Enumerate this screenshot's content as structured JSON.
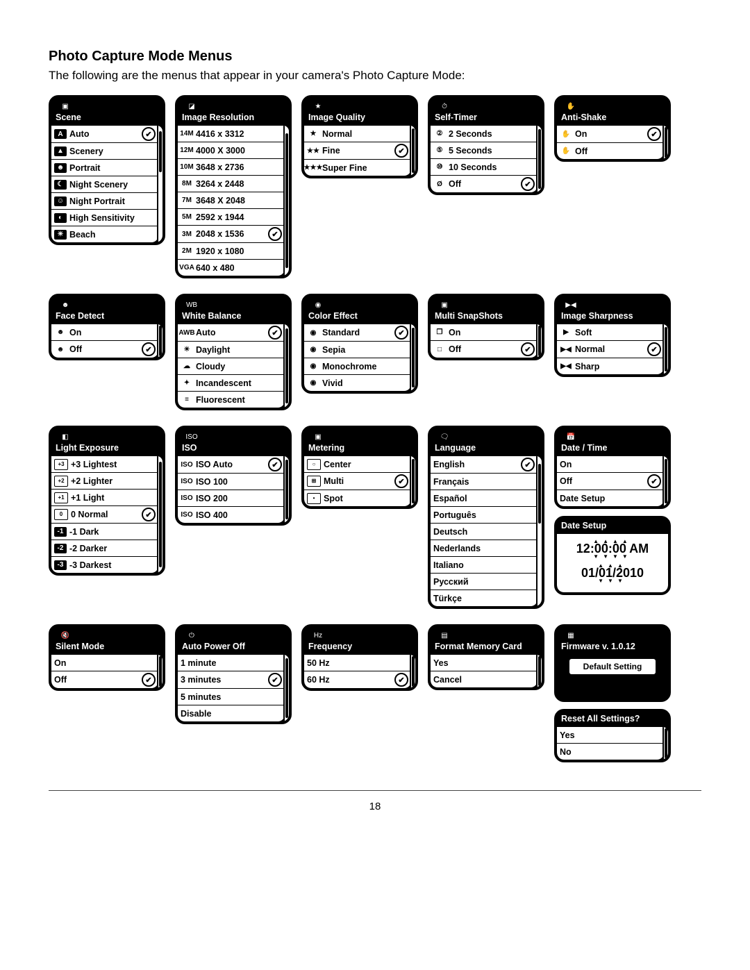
{
  "page": {
    "heading": "Photo Capture Mode Menus",
    "intro": "The following are the menus that appear in your camera's Photo Capture Mode:",
    "number": "18"
  },
  "menus": {
    "scene": {
      "title": "Scene",
      "items": [
        "Auto",
        "Scenery",
        "Portrait",
        "Night Scenery",
        "Night Portrait",
        "High Sensitivity",
        "Beach"
      ],
      "selected_index": 0
    },
    "image_resolution": {
      "title": "Image Resolution",
      "items": [
        {
          "tag": "14M",
          "label": "4416 x 3312"
        },
        {
          "tag": "12M",
          "label": "4000 X 3000"
        },
        {
          "tag": "10M",
          "label": "3648 x 2736"
        },
        {
          "tag": "8M",
          "label": "3264 x 2448"
        },
        {
          "tag": "7M",
          "label": "3648 X 2048"
        },
        {
          "tag": "5M",
          "label": "2592 x 1944"
        },
        {
          "tag": "3M",
          "label": "2048 x 1536"
        },
        {
          "tag": "2M",
          "label": "1920 x 1080"
        },
        {
          "tag": "VGA",
          "label": "640 x 480"
        }
      ],
      "selected_index": 6
    },
    "image_quality": {
      "title": "Image Quality",
      "items": [
        "Normal",
        "Fine",
        "Super Fine"
      ],
      "selected_index": 1
    },
    "self_timer": {
      "title": "Self-Timer",
      "items": [
        "2 Seconds",
        "5 Seconds",
        "10 Seconds",
        "Off"
      ],
      "selected_index": 3
    },
    "anti_shake": {
      "title": "Anti-Shake",
      "items": [
        "On",
        "Off"
      ],
      "selected_index": 0
    },
    "face_detect": {
      "title": "Face Detect",
      "items": [
        "On",
        "Off"
      ],
      "selected_index": 1
    },
    "white_balance": {
      "title": "White Balance",
      "items": [
        "Auto",
        "Daylight",
        "Cloudy",
        "Incandescent",
        "Fluorescent"
      ],
      "selected_index": 0
    },
    "color_effect": {
      "title": "Color Effect",
      "items": [
        "Standard",
        "Sepia",
        "Monochrome",
        "Vivid"
      ],
      "selected_index": 0
    },
    "multi_snapshots": {
      "title": "Multi SnapShots",
      "items": [
        "On",
        "Off"
      ],
      "selected_index": 1
    },
    "image_sharpness": {
      "title": "Image Sharpness",
      "items": [
        "Soft",
        "Normal",
        "Sharp"
      ],
      "selected_index": 1
    },
    "light_exposure": {
      "title": "Light Exposure",
      "items": [
        "+3 Lightest",
        "+2 Lighter",
        "+1 Light",
        "0 Normal",
        "-1 Dark",
        "-2 Darker",
        "-3 Darkest"
      ],
      "selected_index": 3
    },
    "iso": {
      "title": "ISO",
      "items": [
        "ISO Auto",
        "ISO 100",
        "ISO 200",
        "ISO 400"
      ],
      "selected_index": 0
    },
    "metering": {
      "title": "Metering",
      "items": [
        "Center",
        "Multi",
        "Spot"
      ],
      "selected_index": 1
    },
    "language": {
      "title": "Language",
      "items": [
        "English",
        "Français",
        "Español",
        "Português",
        "Deutsch",
        "Nederlands",
        "Italiano",
        "Русский",
        "Türkçe"
      ],
      "selected_index": 0
    },
    "date_time": {
      "title": "Date / Time",
      "items": [
        "On",
        "Off",
        "Date Setup"
      ],
      "selected_index": 1
    },
    "date_setup": {
      "title": "Date Setup",
      "time": "12:00:00 AM",
      "date": "01/01/2010"
    },
    "silent_mode": {
      "title": "Silent Mode",
      "items": [
        "On",
        "Off"
      ],
      "selected_index": 1
    },
    "auto_power_off": {
      "title": "Auto Power Off",
      "items": [
        "1 minute",
        "3 minutes",
        "5 minutes",
        "Disable"
      ],
      "selected_index": 1
    },
    "frequency": {
      "title": "Frequency",
      "items": [
        "50 Hz",
        "60 Hz"
      ],
      "selected_index": 1
    },
    "format_card": {
      "title": "Format Memory Card",
      "items": [
        "Yes",
        "Cancel"
      ],
      "selected_index": -1
    },
    "firmware": {
      "title": "Firmware v. 1.0.12",
      "button": "Default Setting"
    },
    "reset": {
      "title": "Reset All Settings?",
      "items": [
        "Yes",
        "No"
      ],
      "selected_index": -1
    }
  }
}
